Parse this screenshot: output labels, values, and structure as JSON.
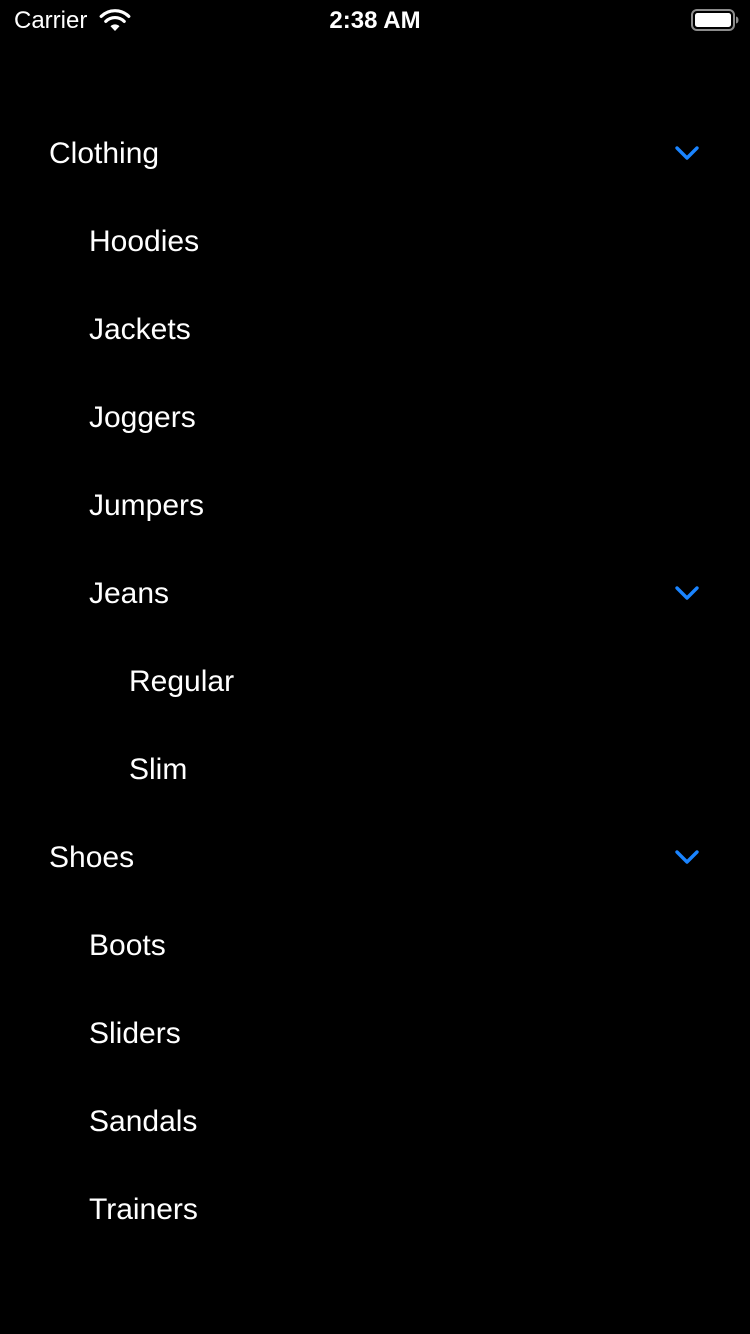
{
  "status_bar": {
    "carrier": "Carrier",
    "time": "2:38 AM",
    "wifi_icon": "wifi-icon",
    "battery_icon": "battery-full-icon"
  },
  "colors": {
    "background": "#000000",
    "text": "#ffffff",
    "accent": "#1a84ff"
  },
  "tree": {
    "expand_icon": "chevron-down-icon",
    "items": [
      {
        "label": "Clothing",
        "level": 0,
        "expanded": true
      },
      {
        "label": "Hoodies",
        "level": 1
      },
      {
        "label": "Jackets",
        "level": 1
      },
      {
        "label": "Joggers",
        "level": 1
      },
      {
        "label": "Jumpers",
        "level": 1
      },
      {
        "label": "Jeans",
        "level": 1,
        "expanded": true
      },
      {
        "label": "Regular",
        "level": 2
      },
      {
        "label": "Slim",
        "level": 2
      },
      {
        "label": "Shoes",
        "level": 0,
        "expanded": true
      },
      {
        "label": "Boots",
        "level": 1
      },
      {
        "label": "Sliders",
        "level": 1
      },
      {
        "label": "Sandals",
        "level": 1
      },
      {
        "label": "Trainers",
        "level": 1
      }
    ]
  }
}
